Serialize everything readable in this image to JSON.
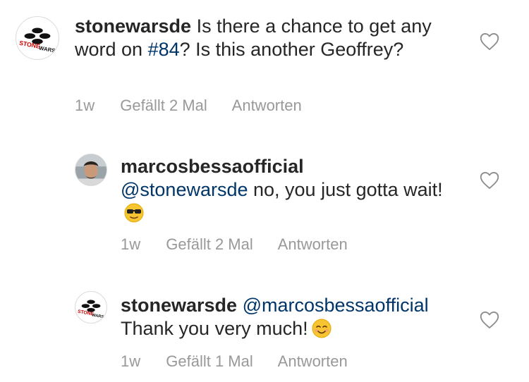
{
  "comments": [
    {
      "username": "stonewarsde",
      "text_before": "Is there a chance to get any word on ",
      "mention": "#84",
      "text_after": "? Is this another Geoffrey?",
      "emoji": "",
      "time": "1w",
      "likes": "Gefällt 2 Mal",
      "reply": "Antworten",
      "avatar": "stonewars-logo"
    },
    {
      "username": "marcosbessaofficial",
      "mention": "@stonewarsde",
      "text_after": " no, you just gotta wait!",
      "emoji": "😎",
      "time": "1w",
      "likes": "Gefällt 2 Mal",
      "reply": "Antworten",
      "avatar": "profile-photo"
    },
    {
      "username": "stonewarsde",
      "mention": "@marcosbessaofficial",
      "text_after": "Thank you very much!",
      "emoji": "😊",
      "time": "1w",
      "likes": "Gefällt 1 Mal",
      "reply": "Antworten",
      "avatar": "stonewars-logo"
    }
  ],
  "colors": {
    "text": "#262626",
    "mention": "#003569",
    "meta": "#999999",
    "heart_stroke": "#8e8e8e"
  },
  "logo_text": "STONEWARS"
}
